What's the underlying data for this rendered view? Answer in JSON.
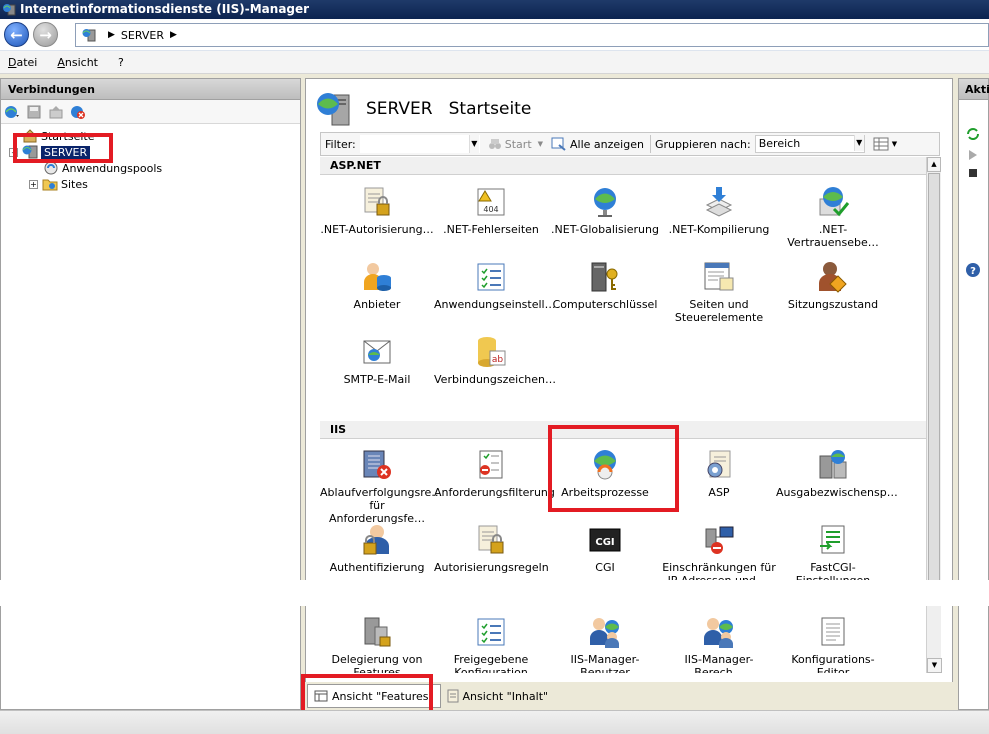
{
  "window": {
    "title": "Internetinformationsdienste (IIS)-Manager"
  },
  "address": {
    "crumb": "SERVER"
  },
  "menu": {
    "items": [
      "Datei",
      "Ansicht",
      "?"
    ]
  },
  "connections": {
    "title": "Verbindungen",
    "tree": {
      "start": "Startseite",
      "server": "SERVER",
      "pools": "Anwendungspools",
      "sites": "Sites"
    }
  },
  "main": {
    "server_name": "SERVER",
    "page_title": "Startseite",
    "filter_label": "Filter:",
    "start_label": "Start",
    "show_all_label": "Alle anzeigen",
    "group_label": "Gruppieren nach:",
    "group_value": "Bereich",
    "sections": [
      {
        "name": "ASP.NET"
      },
      {
        "name": "IIS"
      }
    ],
    "aspnet_features": [
      {
        "label": ".NET-Autorisierung…",
        "icon": "authorization-icon"
      },
      {
        "label": ".NET-Fehlerseiten",
        "icon": "error-pages-icon"
      },
      {
        "label": ".NET-Globalisierung",
        "icon": "globalization-icon"
      },
      {
        "label": ".NET-Kompilierung",
        "icon": "compilation-icon"
      },
      {
        "label": ".NET-Vertrauensebe…",
        "icon": "trust-level-icon"
      },
      {
        "label": "Anbieter",
        "icon": "providers-icon"
      },
      {
        "label": "Anwendungseinstell…",
        "icon": "app-settings-icon"
      },
      {
        "label": "Computerschlüssel",
        "icon": "machine-key-icon"
      },
      {
        "label": "Seiten und Steuerelemente",
        "icon": "pages-controls-icon"
      },
      {
        "label": "Sitzungszustand",
        "icon": "session-state-icon"
      },
      {
        "label": "SMTP-E-Mail",
        "icon": "smtp-email-icon"
      },
      {
        "label": "Verbindungszeichen…",
        "icon": "connection-strings-icon"
      }
    ],
    "iis_features": [
      {
        "label": "Ablaufverfolgungsre… für Anforderungsfe…",
        "icon": "failed-request-tracing-icon"
      },
      {
        "label": "Anforderungsfilterung",
        "icon": "request-filtering-icon"
      },
      {
        "label": "Arbeitsprozesse",
        "icon": "worker-processes-icon"
      },
      {
        "label": "ASP",
        "icon": "asp-icon"
      },
      {
        "label": "Ausgabezwischensp…",
        "icon": "output-caching-icon"
      },
      {
        "label": "Authentifizierung",
        "icon": "authentication-icon"
      },
      {
        "label": "Autorisierungsregeln",
        "icon": "authorization-rules-icon"
      },
      {
        "label": "CGI",
        "icon": "cgi-icon"
      },
      {
        "label": "Einschränkungen für IP-Adressen und …",
        "icon": "ip-restrictions-icon"
      },
      {
        "label": "FastCGI-Einstellungen",
        "icon": "fastcgi-icon"
      },
      {
        "label": "Delegierung von Features",
        "icon": "feature-delegation-icon"
      },
      {
        "label": "Freigegebene Konfiguration",
        "icon": "shared-config-icon"
      },
      {
        "label": "IIS-Manager-Benutzer",
        "icon": "iis-manager-users-icon"
      },
      {
        "label": "IIS-Manager-Berech…",
        "icon": "iis-manager-permissions-icon"
      },
      {
        "label": "Konfigurations-Editor",
        "icon": "config-editor-icon"
      }
    ]
  },
  "view_tabs": {
    "features": "Ansicht \"Features\"",
    "content": "Ansicht \"Inhalt\""
  },
  "actions": {
    "title": "Akti"
  },
  "colors": {
    "highlight": "#e31b23",
    "selection": "#0a246a",
    "titlebar": "#0b2350"
  }
}
